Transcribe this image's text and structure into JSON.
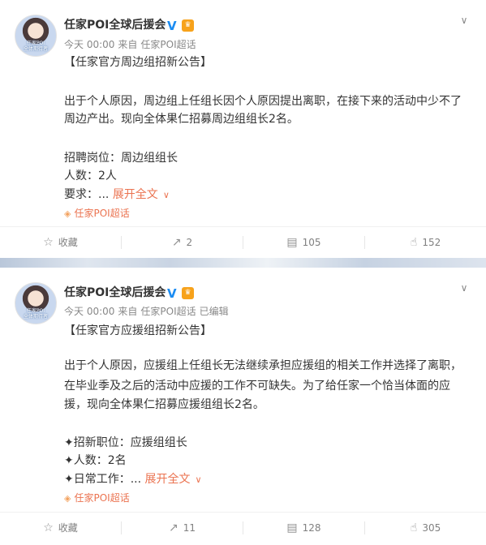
{
  "posts": [
    {
      "username": "任家POI全球后援会",
      "avatar_text": [
        "任家POI",
        "全体期待者"
      ],
      "verified_badge": "V",
      "crown_badge": "♛",
      "meta": {
        "time": "今天 00:00",
        "source_prefix": "来自",
        "source": "任家POI超话"
      },
      "title": "【任家官方周边组招新公告】",
      "paragraph_lines": [
        "出于个人原因，周边组上任组长因个人原因提出离职，在接下来的活动中少不了",
        "周边产出。现向全体果仁招募周边组组长2名。"
      ],
      "fields": [
        "招聘岗位：周边组组长",
        "人数：2人"
      ],
      "last_field": "要求：...",
      "expand_label": "展开全文",
      "topic": "任家POI超话",
      "actions": {
        "favorite": "收藏",
        "repost": "2",
        "comment": "105",
        "like": "152"
      }
    },
    {
      "username": "任家POI全球后援会",
      "avatar_text": [
        "任家POI",
        "全体期待者"
      ],
      "verified_badge": "V",
      "crown_badge": "♛",
      "meta": {
        "time": "今天 00:00",
        "source_prefix": "来自",
        "source": "任家POI超话",
        "edited": "已编辑"
      },
      "title": "【任家官方应援组招新公告】",
      "paragraph_lines": [
        "出于个人原因，应援组上任组长无法继续承担应援组的相关工作并选择了离职，",
        "在毕业季及之后的活动中应援的工作不可缺失。为了给任家一个恰当体面的应",
        "援，现向全体果仁招募应援组组长2名。"
      ],
      "fields": [
        "✦招新职位：应援组组长",
        "✦人数：2名"
      ],
      "last_field": "✦日常工作：...",
      "expand_label": "展开全文",
      "topic": "任家POI超话",
      "actions": {
        "favorite": "收藏",
        "repost": "11",
        "comment": "128",
        "like": "305"
      }
    }
  ]
}
